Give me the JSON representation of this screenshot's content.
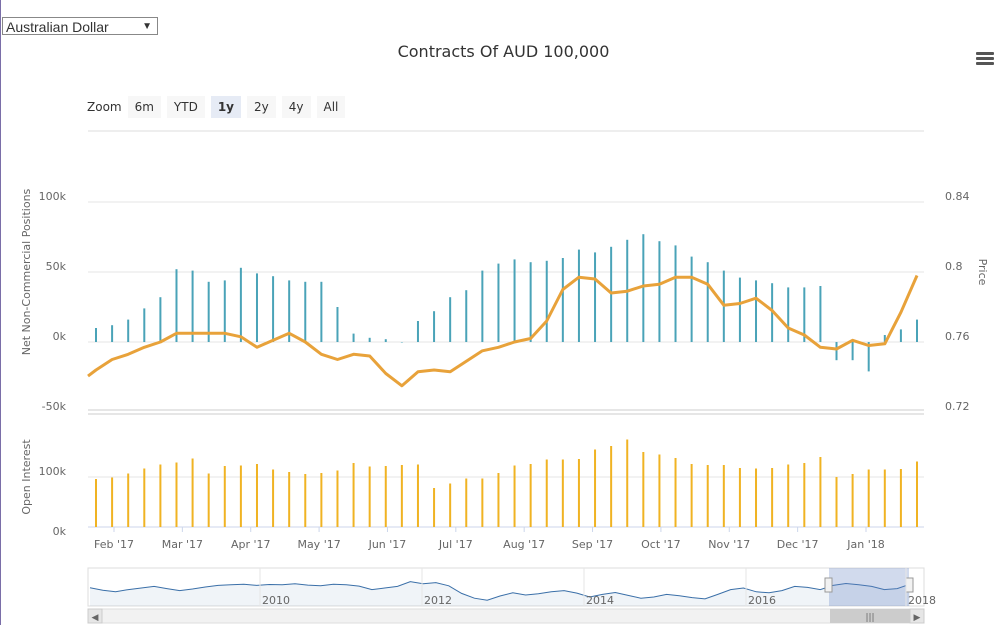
{
  "selector": {
    "value": "Australian Dollar"
  },
  "title": "Contracts Of AUD 100,000",
  "zoom": {
    "label": "Zoom",
    "buttons": [
      "6m",
      "YTD",
      "1y",
      "2y",
      "4y",
      "All"
    ],
    "active": "1y"
  },
  "colors": {
    "positions": "#4aa3b8",
    "price": "#e8a23a",
    "open_interest": "#f0b323",
    "navigator": "#3a6fa8"
  },
  "chart_data": [
    {
      "type": "bar",
      "title": "Contracts Of AUD 100,000",
      "x_tick_labels": [
        "Feb '17",
        "Mar '17",
        "Apr '17",
        "May '17",
        "Jun '17",
        "Jul '17",
        "Aug '17",
        "Sep '17",
        "Oct '17",
        "Nov '17",
        "Dec '17",
        "Jan '18"
      ],
      "ylabel": "Net Non-Commercial Positions",
      "ylim": [
        -50000,
        100000
      ],
      "y_tick_labels": [
        "100k",
        "50k",
        "0k",
        "-50k"
      ],
      "series": [
        {
          "name": "Net Non-Commercial Positions",
          "values": [
            10000,
            12000,
            16000,
            24000,
            32000,
            52000,
            51000,
            43000,
            44000,
            53000,
            49000,
            47000,
            44000,
            43000,
            43000,
            25000,
            6000,
            3000,
            2000,
            0,
            15000,
            22000,
            32000,
            37000,
            51000,
            56000,
            59000,
            57000,
            58000,
            60000,
            66000,
            64000,
            68000,
            73000,
            77000,
            72000,
            69000,
            61000,
            57000,
            51000,
            46000,
            44000,
            42000,
            39000,
            39000,
            40000,
            -13000,
            -13000,
            -21000,
            5000,
            9000,
            16000
          ]
        }
      ]
    },
    {
      "type": "line",
      "ylabel": "Price",
      "ylim": [
        0.72,
        0.84
      ],
      "y_tick_labels": [
        "0.84",
        "0.8",
        "0.76",
        "0.72"
      ],
      "series": [
        {
          "name": "Price",
          "values": [
            0.744,
            0.75,
            0.753,
            0.757,
            0.76,
            0.765,
            0.765,
            0.765,
            0.765,
            0.763,
            0.757,
            0.761,
            0.765,
            0.76,
            0.753,
            0.75,
            0.753,
            0.752,
            0.742,
            0.735,
            0.743,
            0.744,
            0.743,
            0.749,
            0.755,
            0.757,
            0.76,
            0.762,
            0.772,
            0.79,
            0.797,
            0.796,
            0.788,
            0.789,
            0.792,
            0.793,
            0.797,
            0.797,
            0.793,
            0.781,
            0.782,
            0.785,
            0.778,
            0.768,
            0.764,
            0.757,
            0.756,
            0.761,
            0.758,
            0.759,
            0.777,
            0.798
          ]
        }
      ]
    },
    {
      "type": "bar",
      "ylabel": "Open Interest",
      "y_tick_labels": [
        "100k",
        "0k"
      ],
      "series": [
        {
          "name": "Open Interest",
          "values": [
            96000,
            99000,
            107000,
            117000,
            125000,
            129000,
            137000,
            107000,
            122000,
            123000,
            126000,
            115000,
            110000,
            106000,
            108000,
            113000,
            128000,
            121000,
            122000,
            124000,
            125000,
            78000,
            87000,
            97000,
            97000,
            108000,
            123000,
            126000,
            135000,
            135000,
            136000,
            155000,
            162000,
            175000,
            150000,
            145000,
            138000,
            126000,
            124000,
            124000,
            118000,
            117000,
            118000,
            125000,
            128000,
            140000,
            100000,
            106000,
            115000,
            115000,
            116000,
            131000
          ]
        }
      ]
    },
    {
      "type": "line",
      "x_tick_labels": [
        "2010",
        "2012",
        "2014",
        "2016",
        "2018"
      ],
      "series": [
        {
          "name": "Navigator",
          "values": [
            0.51,
            0.43,
            0.38,
            0.45,
            0.5,
            0.55,
            0.48,
            0.42,
            0.47,
            0.53,
            0.58,
            0.6,
            0.62,
            0.58,
            0.61,
            0.6,
            0.63,
            0.59,
            0.57,
            0.62,
            0.6,
            0.56,
            0.45,
            0.5,
            0.55,
            0.7,
            0.63,
            0.67,
            0.57,
            0.33,
            0.18,
            0.12,
            0.25,
            0.35,
            0.28,
            0.32,
            0.38,
            0.42,
            0.34,
            0.22,
            0.3,
            0.36,
            0.27,
            0.18,
            0.22,
            0.3,
            0.26,
            0.2,
            0.16,
            0.3,
            0.45,
            0.5,
            0.38,
            0.35,
            0.42,
            0.55,
            0.52,
            0.45,
            0.58,
            0.64,
            0.6,
            0.55,
            0.45,
            0.48,
            0.62
          ]
        }
      ]
    }
  ]
}
